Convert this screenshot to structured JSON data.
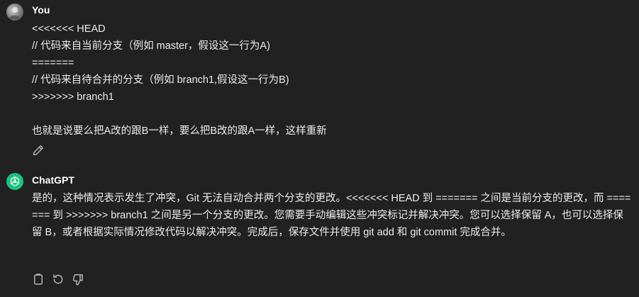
{
  "conversation": {
    "user_message": {
      "author": "You",
      "avatar_icon": "user-avatar-icon",
      "lines": [
        "<<<<<<< HEAD",
        "// 代码来自当前分支（例如 master，假设这一行为A)",
        "=======",
        "// 代码来自待合并的分支（例如 branch1,假设这一行为B)",
        ">>>>>>> branch1",
        "",
        "也就是说要么把A改的跟B一样，要么把B改的跟A一样，这样重新"
      ],
      "actions": [
        "edit-icon"
      ]
    },
    "assistant_message": {
      "author": "ChatGPT",
      "avatar_icon": "openai-logo-icon",
      "brand_color": "#19c37d",
      "text": "是的，这种情况表示发生了冲突，Git 无法自动合并两个分支的更改。<<<<<<< HEAD 到 ======= 之间是当前分支的更改，而 ======= 到 >>>>>>> branch1 之间是另一个分支的更改。您需要手动编辑这些冲突标记并解决冲突。您可以选择保留 A，也可以选择保留 B，或者根据实际情况修改代码以解决冲突。完成后，保存文件并使用 git add 和 git commit 完成合并。",
      "actions": [
        "copy-icon",
        "regenerate-icon",
        "thumbs-down-icon"
      ]
    }
  },
  "theme": {
    "background": "#212121",
    "text": "#ececec",
    "icon": "#b4b4b4"
  }
}
